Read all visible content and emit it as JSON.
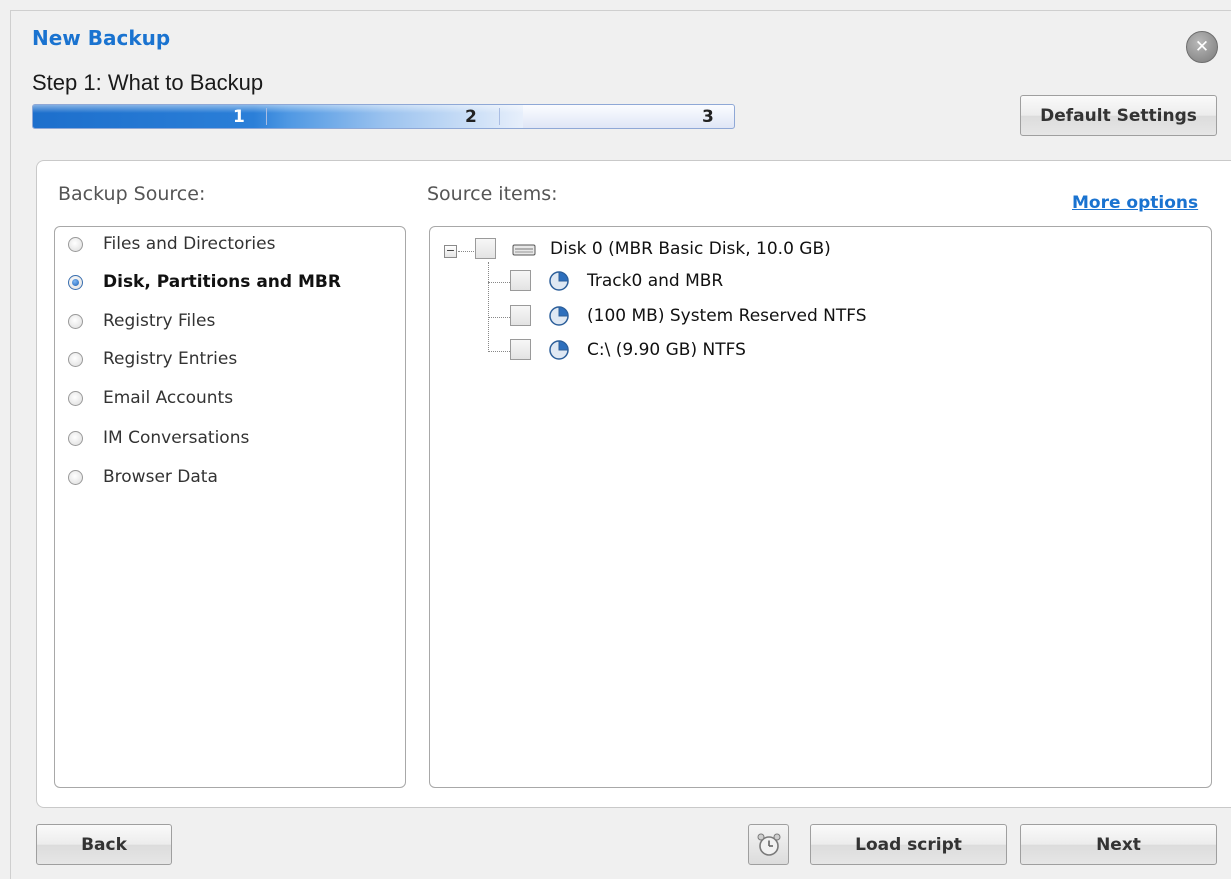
{
  "window": {
    "title": "New Backup",
    "step_label": "Step 1: What to Backup"
  },
  "progress": {
    "steps": [
      "1",
      "2",
      "3"
    ],
    "current_step": 1
  },
  "toolbar": {
    "default_settings_label": "Default Settings",
    "close_icon": "close-icon"
  },
  "backup_source": {
    "label": "Backup Source:",
    "options": [
      {
        "label": "Files and Directories",
        "selected": false
      },
      {
        "label": "Disk, Partitions and MBR",
        "selected": true
      },
      {
        "label": "Registry Files",
        "selected": false
      },
      {
        "label": "Registry Entries",
        "selected": false
      },
      {
        "label": "Email Accounts",
        "selected": false
      },
      {
        "label": "IM Conversations",
        "selected": false
      },
      {
        "label": "Browser Data",
        "selected": false
      }
    ]
  },
  "source_items": {
    "label": "Source items:",
    "more_options_label": "More options",
    "tree": {
      "root": {
        "label": "Disk 0 (MBR Basic Disk, 10.0 GB)",
        "icon": "hard-disk-icon",
        "checked": false,
        "expanded": true
      },
      "children": [
        {
          "label": "Track0 and MBR",
          "icon": "partition-pie-icon",
          "checked": false
        },
        {
          "label": "(100 MB) System Reserved NTFS",
          "icon": "partition-pie-icon",
          "checked": false
        },
        {
          "label": "C:\\ (9.90 GB) NTFS",
          "icon": "partition-pie-icon",
          "checked": false
        }
      ]
    }
  },
  "footer": {
    "back_label": "Back",
    "schedule_icon": "alarm-clock-icon",
    "load_script_label": "Load script",
    "next_label": "Next"
  },
  "colors": {
    "accent": "#1a73d0",
    "progress_fill": "#2b7fd8"
  }
}
